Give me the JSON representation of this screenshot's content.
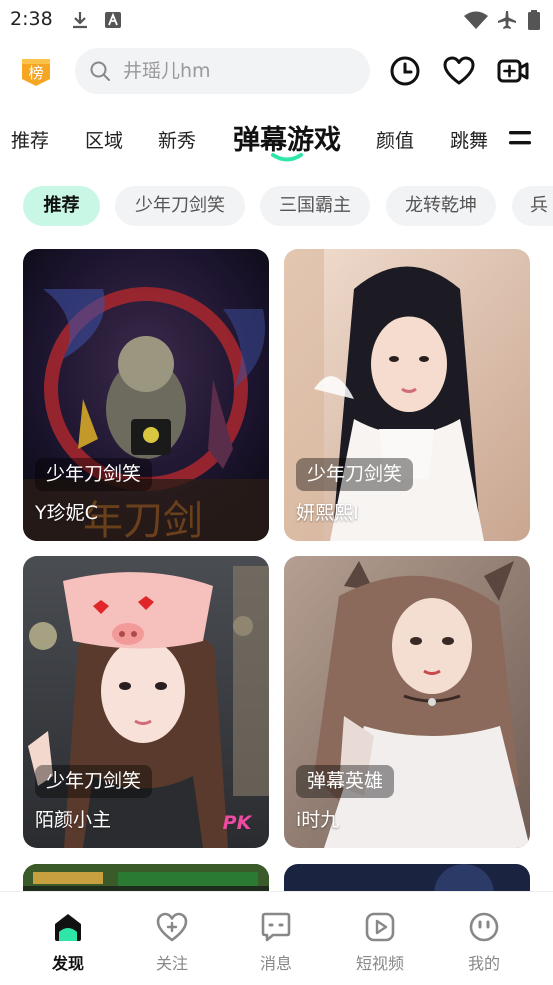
{
  "status_bar": {
    "time": "2:38"
  },
  "search": {
    "placeholder": "井瑶儿hm"
  },
  "tabs": [
    {
      "label": "推荐"
    },
    {
      "label": "区域"
    },
    {
      "label": "新秀"
    },
    {
      "label": "弹幕游戏",
      "active": true
    },
    {
      "label": "颜值"
    },
    {
      "label": "跳舞"
    }
  ],
  "chips": [
    {
      "label": "推荐",
      "active": true
    },
    {
      "label": "少年刀剑笑"
    },
    {
      "label": "三国霸主"
    },
    {
      "label": "龙转乾坤"
    },
    {
      "label": "兵"
    }
  ],
  "cards": [
    {
      "tag": "少年刀剑笑",
      "name": "Y珍妮C"
    },
    {
      "tag": "少年刀剑笑",
      "name": "妍熙熙I"
    },
    {
      "tag": "少年刀剑笑",
      "name": "陌颜小主",
      "badge": "PK"
    },
    {
      "tag": "弹幕英雄",
      "name": "i时九"
    }
  ],
  "bottom_nav": [
    {
      "label": "发现",
      "icon": "home-icon",
      "active": true
    },
    {
      "label": "关注",
      "icon": "heart-plus-icon"
    },
    {
      "label": "消息",
      "icon": "message-icon"
    },
    {
      "label": "短视频",
      "icon": "play-icon"
    },
    {
      "label": "我的",
      "icon": "face-icon"
    }
  ],
  "colors": {
    "accent": "#2ee6a8",
    "chip_active_bg": "#c9f7e6",
    "rank_badge": "#f5a623"
  }
}
